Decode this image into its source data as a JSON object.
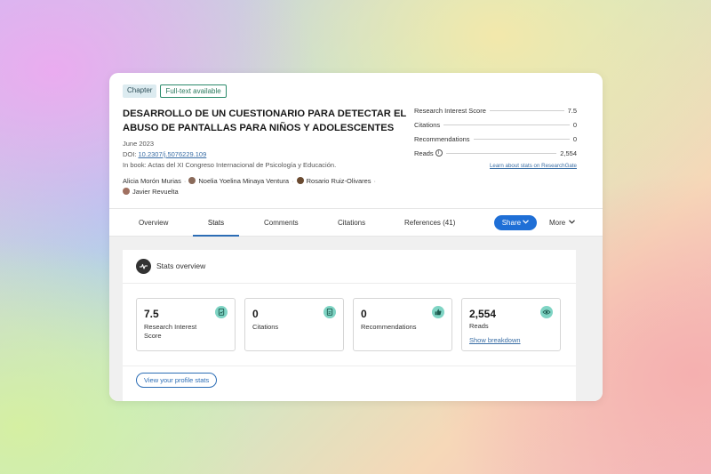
{
  "badges": {
    "chapter": "Chapter",
    "fulltext": "Full-text available"
  },
  "title": "DESARROLLO DE UN CUESTIONARIO PARA DETECTAR EL ABUSO DE PANTALLAS PARA NIÑOS Y ADOLESCENTES",
  "date": "June 2023",
  "doi_prefix": "DOI: ",
  "doi": "10.2307/j.5076229.109",
  "book": "In book: Actas del XI Congreso Internacional de Psicología y Educación.",
  "authors": [
    "Alicia Morón Murias",
    "Noelia Yoelina Minaya Ventura",
    "Rosario Ruiz-Olivares",
    "Javier Revuelta"
  ],
  "summary_stats": [
    {
      "label": "Research Interest Score",
      "value": "7.5"
    },
    {
      "label": "Citations",
      "value": "0"
    },
    {
      "label": "Recommendations",
      "value": "0"
    },
    {
      "label": "Reads",
      "value": "2,554"
    }
  ],
  "learn_link": "Learn about stats on ResearchGate",
  "tabs": [
    "Overview",
    "Stats",
    "Comments",
    "Citations",
    "References (41)"
  ],
  "share_label": "Share",
  "more_label": "More",
  "panel_title": "Stats overview",
  "tiles": [
    {
      "value": "7.5",
      "label": "Research Interest Score"
    },
    {
      "value": "0",
      "label": "Citations"
    },
    {
      "value": "0",
      "label": "Recommendations"
    },
    {
      "value": "2,554",
      "label": "Reads",
      "link": "Show breakdown"
    }
  ],
  "profile_button": "View your profile stats",
  "colors": {
    "accent": "#1f6fd6",
    "icon_bg": "#7fd4c4"
  }
}
